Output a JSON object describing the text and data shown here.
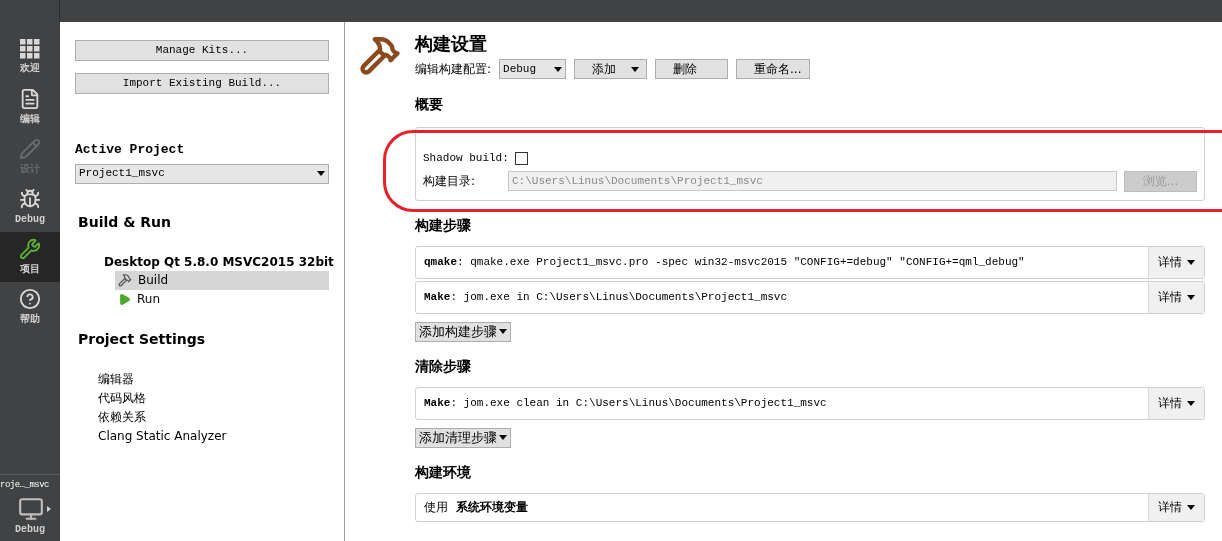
{
  "mode_bar": {
    "modes": [
      {
        "label": "欢迎",
        "kind": "grid",
        "selected": false,
        "disabled": false
      },
      {
        "label": "编辑",
        "kind": "document",
        "selected": false,
        "disabled": false
      },
      {
        "label": "设计",
        "kind": "pencil",
        "selected": false,
        "disabled": true
      },
      {
        "label": "Debug",
        "kind": "bug",
        "selected": false,
        "disabled": false
      },
      {
        "label": "项目",
        "kind": "wrench",
        "selected": true,
        "disabled": false
      },
      {
        "label": "帮助",
        "kind": "help",
        "selected": false,
        "disabled": false
      }
    ],
    "target": {
      "project": "roje…_msvc",
      "config": "Debug"
    }
  },
  "left_panel": {
    "buttons": [
      "Manage Kits...",
      "Import Existing Build..."
    ],
    "active_project": {
      "heading": "Active Project",
      "value": "Project1_msvc"
    },
    "build_run": {
      "heading": "Build & Run",
      "kit": "Desktop Qt 5.8.0 MSVC2015 32bit",
      "items": [
        {
          "label": "Build",
          "kind": "build",
          "selected": true
        },
        {
          "label": "Run",
          "kind": "run",
          "selected": false
        }
      ]
    },
    "project_settings": {
      "heading": "Project Settings",
      "items": [
        "编辑器",
        "代码风格",
        "依赖关系",
        "Clang Static Analyzer"
      ]
    }
  },
  "build_settings": {
    "title": "构建设置",
    "config_label": "编辑构建配置:",
    "config_value": "Debug",
    "buttons": [
      {
        "label": "添加",
        "kind": "menu"
      },
      {
        "label": "删除",
        "kind": "plain"
      },
      {
        "label": "重命名...",
        "kind": "plain"
      }
    ],
    "overview": {
      "heading": "概要",
      "shadow_label": "Shadow build:",
      "shadow_checked": false,
      "dir_label": "构建目录:",
      "dir_value": "C:\\Users\\Linus\\Documents\\Project1_msvc",
      "browse": "浏览...",
      "browse_disabled": true
    },
    "sections": [
      {
        "heading": "构建步骤",
        "steps": [
          {
            "text": "**qmake**: qmake.exe Project1_msvc.pro -spec win32-msvc2015 \"CONFIG+=debug\" \"CONFIG+=qml_debug\"",
            "details": "详情"
          },
          {
            "text": "**Make**: jom.exe in C:\\Users\\Linus\\Documents\\Project1_msvc",
            "details": "详情"
          }
        ],
        "add": "添加构建步骤"
      },
      {
        "heading": "清除步骤",
        "steps": [
          {
            "text": "**Make**: jom.exe clean in C:\\Users\\Linus\\Documents\\Project1_msvc",
            "details": "详情"
          }
        ],
        "add": "添加清理步骤"
      }
    ],
    "environment": {
      "heading": "构建环境",
      "text": "使用  **系统环境变量**",
      "details": "详情"
    }
  }
}
